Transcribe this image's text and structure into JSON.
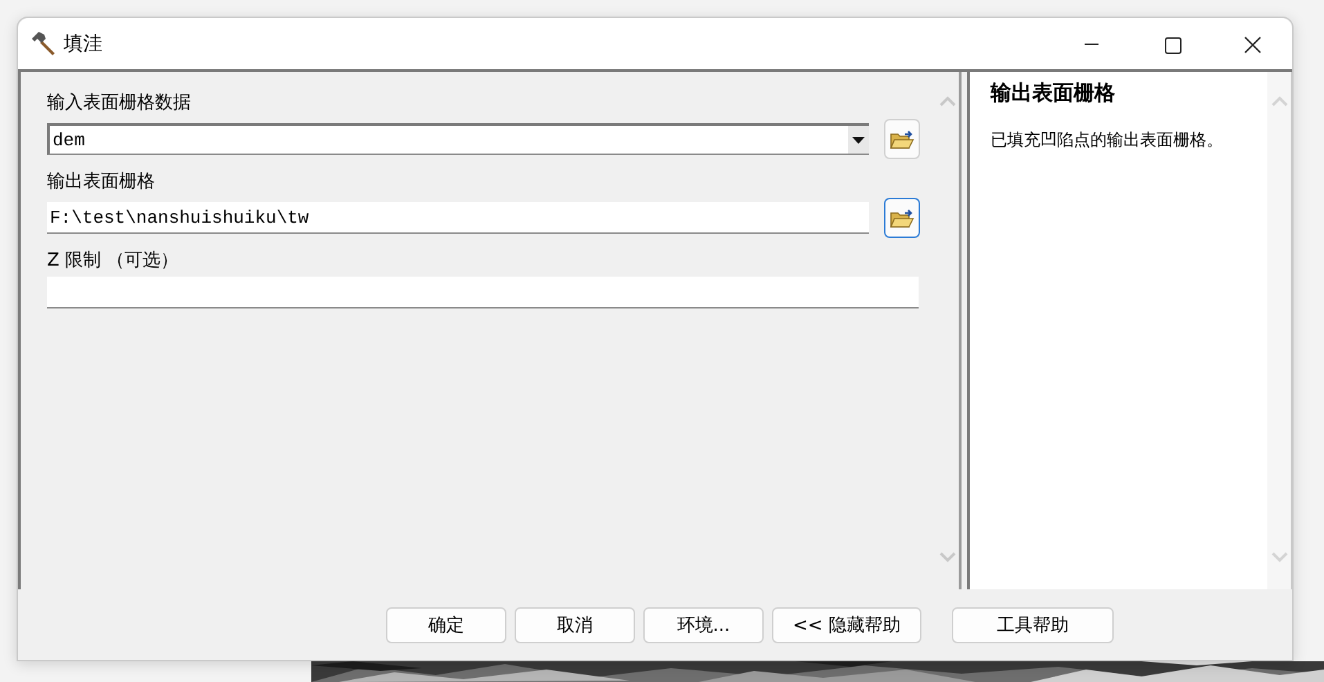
{
  "window": {
    "title": "填洼"
  },
  "parameters": [
    {
      "label": "输入表面栅格数据",
      "kind": "combo",
      "value": "dem",
      "browse": true,
      "focused": false
    },
    {
      "label": "输出表面栅格",
      "kind": "text",
      "value": "F:\\test\\nanshuishuiku\\tw",
      "browse": true,
      "focused": true
    },
    {
      "label": "Z 限制 （可选）",
      "kind": "text",
      "browse": false
    }
  ],
  "help": {
    "title": "输出表面栅格",
    "text": "已填充凹陷点的输出表面栅格。"
  },
  "buttons": [
    {
      "label": "确定",
      "kind": "normal"
    },
    {
      "label": "取消",
      "kind": "normal"
    },
    {
      "label": "环境...",
      "kind": "normal"
    },
    {
      "label": "<< 隐藏帮助",
      "kind": "normal"
    },
    {
      "label": "工具帮助",
      "kind": "separated"
    }
  ]
}
